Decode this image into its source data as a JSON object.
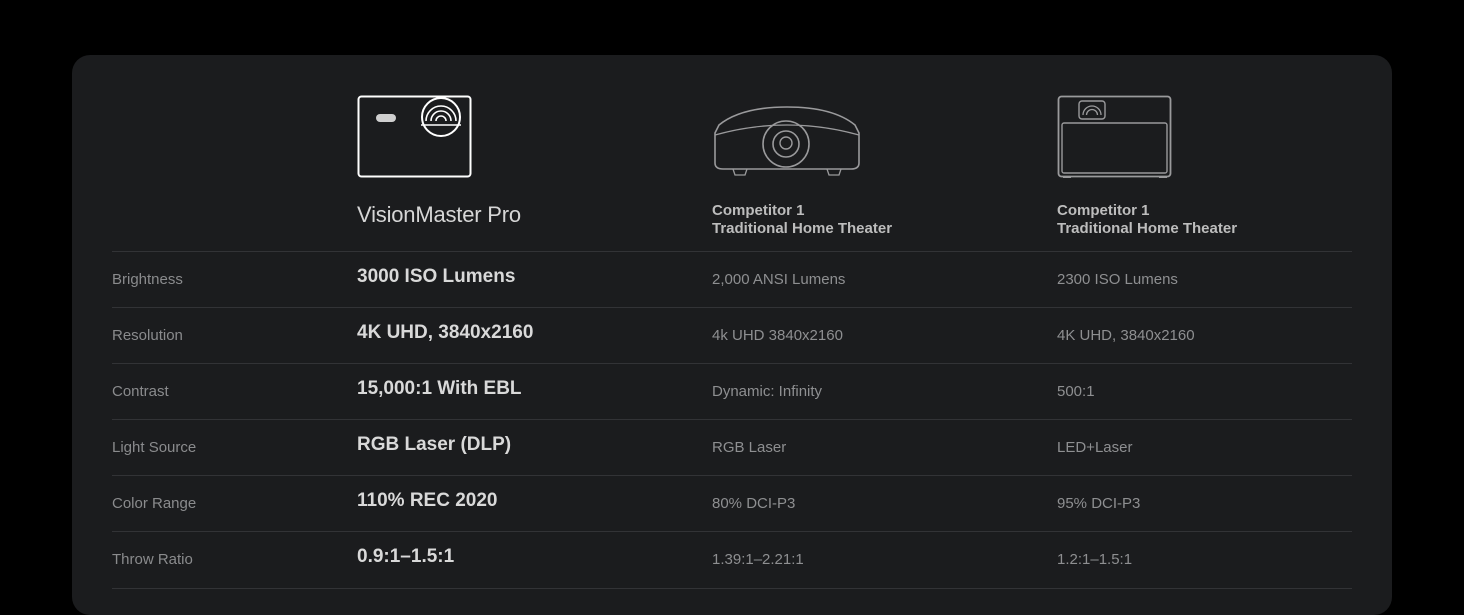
{
  "columns": {
    "main": {
      "name": "VisionMaster Pro",
      "icon": "projector-compact-icon"
    },
    "competitor1": {
      "line1": "Competitor 1",
      "line2": "Traditional Home Theater",
      "icon": "projector-home-theater-icon"
    },
    "competitor2": {
      "line1": "Competitor 1",
      "line2": "Traditional Home Theater",
      "icon": "projector-box-icon"
    }
  },
  "rows": [
    {
      "label": "Brightness",
      "main": "3000 ISO Lumens",
      "c1": "2,000 ANSI Lumens",
      "c2": "2300 ISO Lumens"
    },
    {
      "label": "Resolution",
      "main": "4K UHD, 3840x2160",
      "c1": "4k UHD 3840x2160",
      "c2": "4K UHD, 3840x2160"
    },
    {
      "label": "Contrast",
      "main": "15,000:1 With EBL",
      "c1": "Dynamic: Infinity",
      "c2": "500:1"
    },
    {
      "label": "Light Source",
      "main": "RGB Laser (DLP)",
      "c1": "RGB Laser",
      "c2": "LED+Laser"
    },
    {
      "label": "Color Range",
      "main": "110% REC 2020",
      "c1": "80% DCI-P3",
      "c2": "95% DCI-P3"
    },
    {
      "label": "Throw Ratio",
      "main": "0.9:1–1.5:1",
      "c1": "1.39:1–2.21:1",
      "c2": "1.2:1–1.5:1"
    }
  ],
  "colors": {
    "page_background": "#000000",
    "card_background": "#1b1c1e",
    "divider": "#323336",
    "primary_text": "#d9d9d9",
    "secondary_text": "#8e8f91"
  }
}
